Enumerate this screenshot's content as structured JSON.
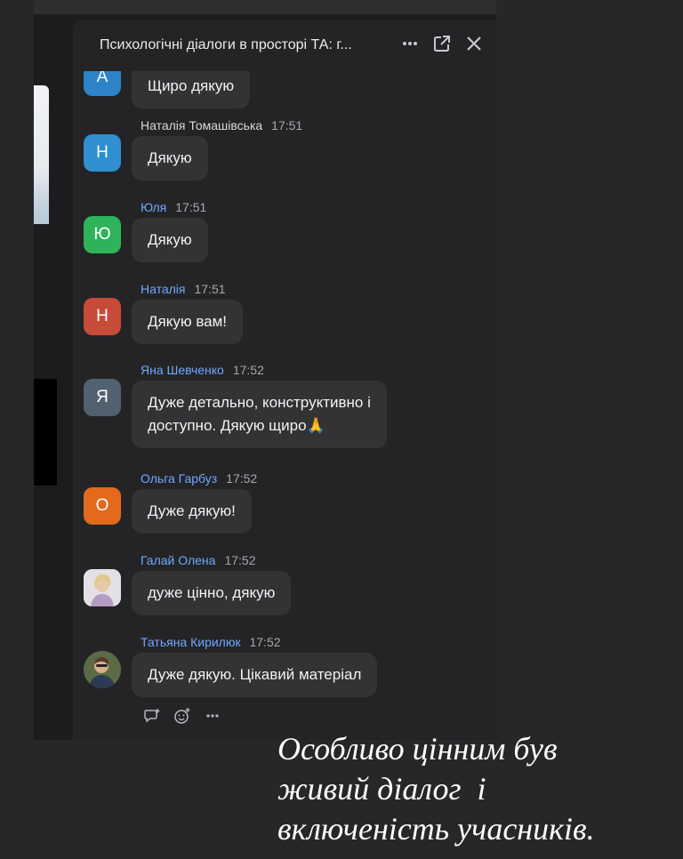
{
  "chat": {
    "title": "Психологічні діалоги в просторі ТА: г...",
    "messages": [
      {
        "initial": "А",
        "sender": "",
        "time": "",
        "text": "Щиро дякую",
        "color": "#2e83c9"
      },
      {
        "initial": "Н",
        "sender": "Наталія Томашівська",
        "time": "17:51",
        "text": "Дякую",
        "color": "#2f8fd0"
      },
      {
        "initial": "Ю",
        "sender": "Юля",
        "time": "17:51",
        "text": "Дякую",
        "color": "#2fb35a"
      },
      {
        "initial": "Н",
        "sender": "Наталія",
        "time": "17:51",
        "text": "Дякую вам!",
        "color": "#c84b3a"
      },
      {
        "initial": "Я",
        "sender": "Яна Шевченко",
        "time": "17:52",
        "text_line1": "Дуже детально, конструктивно і",
        "text_line2": "доступно. Дякую щиро🙏",
        "color": "#526170"
      },
      {
        "initial": "О",
        "sender": "Ольга Гарбуз",
        "time": "17:52",
        "text": "Дуже дякую!",
        "color": "#e36a1c"
      },
      {
        "initial": "",
        "sender": "Галай Олена",
        "time": "17:52",
        "text": "дуже цінно, дякую",
        "color": "#c9c4cc"
      },
      {
        "initial": "",
        "sender": "Татьяна Кирилюк",
        "time": "17:52",
        "text": "Дуже дякую. Цікавий матеріал",
        "color": "#5a6a4a"
      }
    ]
  },
  "caption": {
    "line1": "Особливо цінним був",
    "line2": "живий діалог  і",
    "line3": "включеність учасників."
  }
}
